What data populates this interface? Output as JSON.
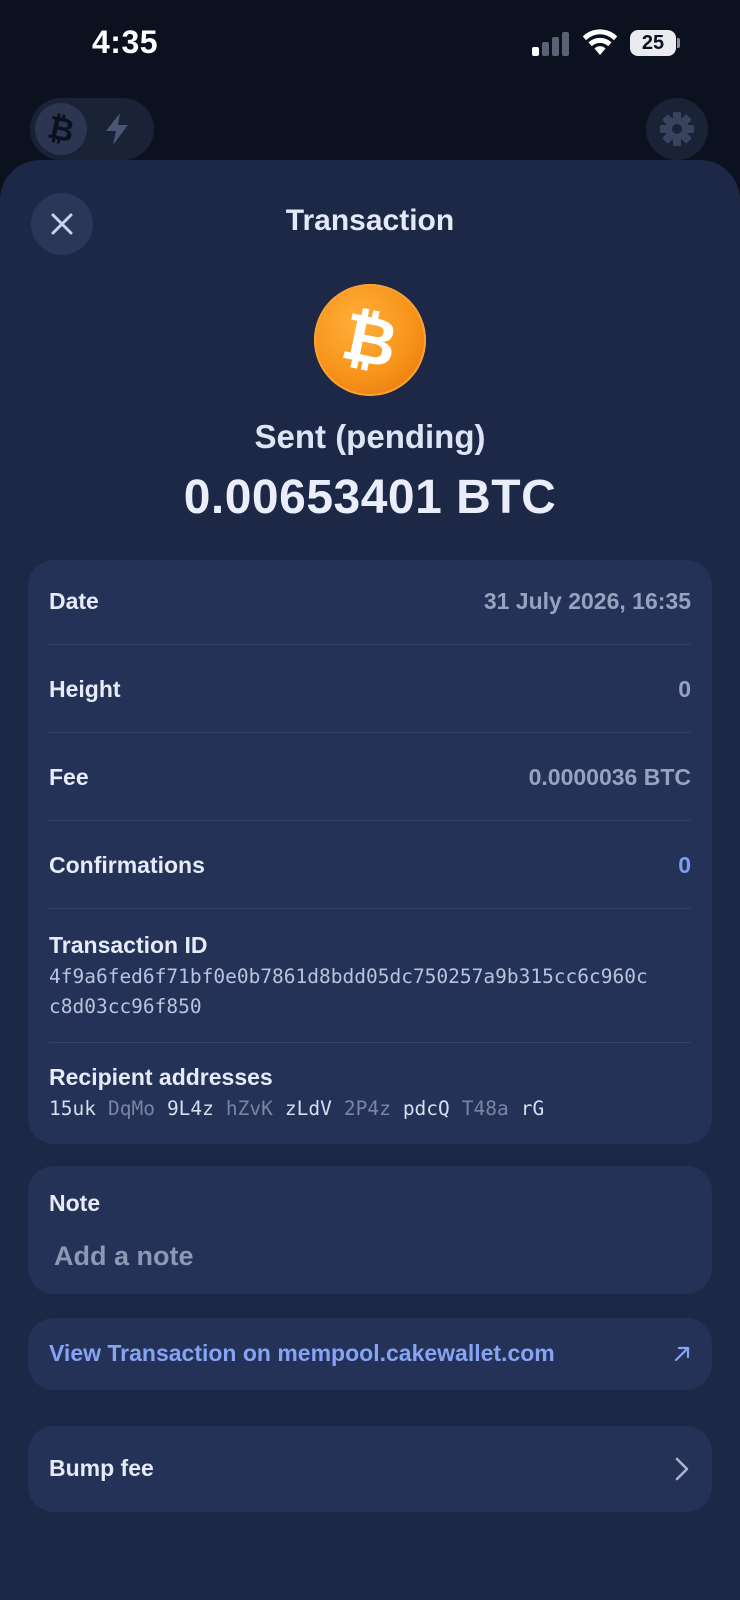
{
  "status_bar": {
    "time": "4:35",
    "battery": "25",
    "icons": [
      "signal-icon",
      "wifi-icon",
      "battery-icon"
    ]
  },
  "background_header": {
    "icons": [
      "bitcoin-icon",
      "lightning-icon",
      "gear-icon"
    ]
  },
  "sheet": {
    "title": "Transaction",
    "close_icon": "close-icon",
    "coin_icon": "bitcoin-icon",
    "coin_glyph": "₿",
    "status": "Sent (pending)",
    "amount": "0.00653401 BTC"
  },
  "details": {
    "date": {
      "label": "Date",
      "value": "31 July 2026, 16:35"
    },
    "height": {
      "label": "Height",
      "value": "0"
    },
    "fee": {
      "label": "Fee",
      "value": "0.0000036 BTC"
    },
    "confirmations": {
      "label": "Confirmations",
      "value": "0"
    },
    "transaction_id": {
      "label": "Transaction ID",
      "line1": "4f9a6fed6f71bf0e0b7861d8bdd05dc750257a9b315cc6c960c",
      "line2": "c8d03cc96f850"
    },
    "recipient": {
      "label": "Recipient addresses",
      "chunks": [
        "15uk",
        "DqMo",
        "9L4z",
        "hZvK",
        "zLdV",
        "2P4z",
        "pdcQ",
        "T48a",
        "rG"
      ]
    }
  },
  "note": {
    "label": "Note",
    "placeholder": "Add a note",
    "value": ""
  },
  "explorer_link": {
    "label": "View Transaction on mempool.cakewallet.com",
    "icon": "external-link-icon"
  },
  "bump_fee": {
    "label": "Bump fee",
    "icon": "chevron-right-icon"
  },
  "colors": {
    "background": "#0c1120",
    "sheet": "#1d2847",
    "card": "#243258",
    "accent": "#86a4f4",
    "bitcoin": "#f7931a"
  }
}
